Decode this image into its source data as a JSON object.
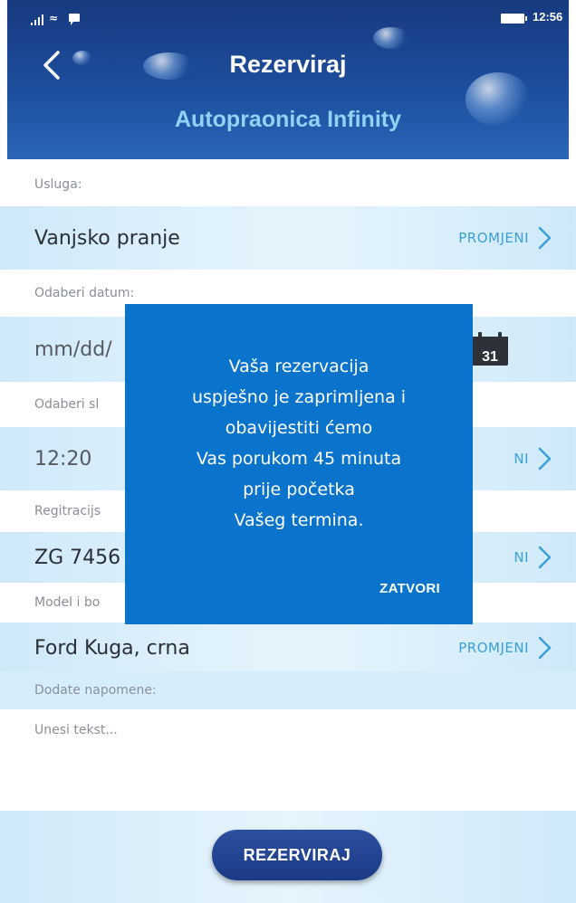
{
  "status_bar": {
    "time": "12:56"
  },
  "header": {
    "title": "Rezerviraj",
    "subtitle": "Autopraonica Infinity"
  },
  "form": {
    "service_label": "Usluga:",
    "service_value": "Vanjsko pranje",
    "date_label": "Odaberi datum:",
    "date_value": "mm/dd/",
    "calendar_day": "31",
    "slot_label": "Odaberi sl",
    "slot_value": "12:20",
    "registration_label": "Regitracijs",
    "registration_value": "ZG 7456",
    "model_label": "Model i bo",
    "model_value": "Ford Kuga, crna",
    "change_label": "PROMJENI",
    "change_partial": "NI",
    "notes_label": "Dodate napomene:",
    "notes_placeholder": "Unesi tekst..."
  },
  "reserve_button": "REZERVIRAJ",
  "modal": {
    "lines": [
      "Vaša rezervacija",
      "uspješno je zaprimljena i",
      "obavijestiti ćemo",
      "Vas porukom 45 minuta",
      "prije početka",
      "Vašeg termina."
    ],
    "close_label": "ZATVORI"
  },
  "colors": {
    "header_bg": "#1d4d9c",
    "accent": "#3aa0d8",
    "modal_bg": "#0a74cc",
    "row_bg": "#d6eefb",
    "button_bg": "#1a3a85"
  },
  "icons": [
    "signal-icon",
    "wifi-icon",
    "message-icon",
    "battery-icon",
    "back-arrow-icon",
    "chevron-right-icon",
    "calendar-icon"
  ]
}
